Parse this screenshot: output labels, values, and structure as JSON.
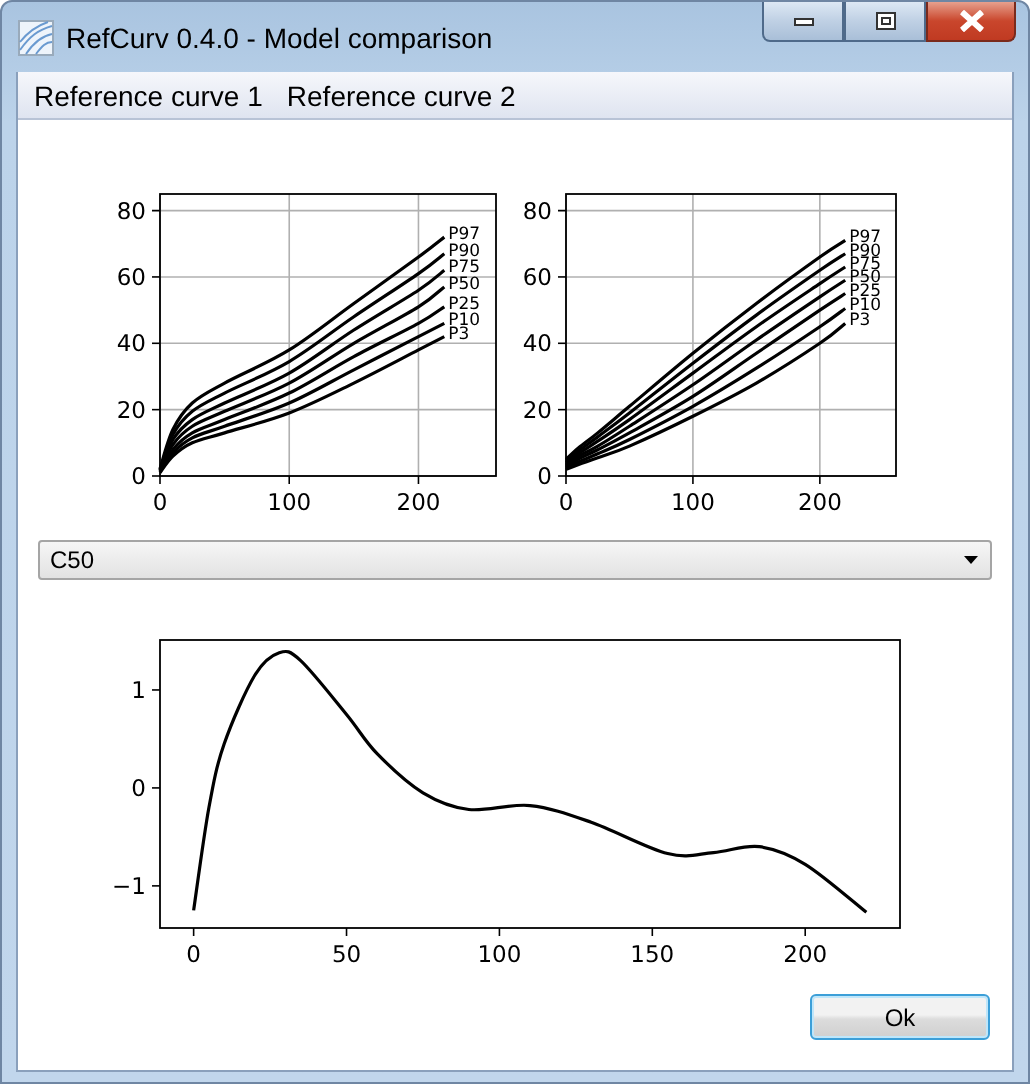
{
  "window": {
    "title": "RefCurv 0.4.0 - Model comparison"
  },
  "menu": [
    "Reference curve 1",
    "Reference curve 2"
  ],
  "curve_plots": [
    {
      "chart_data": {
        "type": "line",
        "grid": true,
        "x": [
          0,
          10,
          25,
          50,
          100,
          150,
          200,
          220
        ],
        "xlim": [
          0,
          260
        ],
        "ylim": [
          0,
          85
        ],
        "xticks": [
          0,
          100,
          200
        ],
        "yticks": [
          0,
          20,
          40,
          60,
          80
        ],
        "series": [
          {
            "name": "P97",
            "color": "#000000",
            "values": [
              2.2,
              14,
              22,
              28,
              38,
              52,
              66,
              72
            ]
          },
          {
            "name": "P90",
            "color": "#000000",
            "values": [
              2,
              12.5,
              19.5,
              25,
              34.5,
              48,
              61,
              67
            ]
          },
          {
            "name": "P75",
            "color": "#000000",
            "values": [
              1.8,
              11,
              17,
              22,
              31,
              44,
              56,
              62
            ]
          },
          {
            "name": "P50",
            "color": "#000000",
            "values": [
              1.6,
              9.5,
              15,
              19.5,
              28,
              40,
              51,
              57
            ]
          },
          {
            "name": "P25",
            "color": "#000000",
            "values": [
              1.4,
              8,
              13,
              17,
              25,
              36,
              46,
              51
            ]
          },
          {
            "name": "P10",
            "color": "#000000",
            "values": [
              1.2,
              7,
              11.5,
              15,
              22,
              32,
              42,
              46
            ]
          },
          {
            "name": "P3",
            "color": "#000000",
            "values": [
              1,
              6,
              10,
              13,
              19,
              28,
              38,
              42
            ]
          }
        ]
      }
    },
    {
      "chart_data": {
        "type": "line",
        "grid": true,
        "x": [
          0,
          10,
          25,
          50,
          100,
          150,
          200,
          220
        ],
        "xlim": [
          0,
          260
        ],
        "ylim": [
          0,
          85
        ],
        "xticks": [
          0,
          100,
          200
        ],
        "yticks": [
          0,
          20,
          40,
          60,
          80
        ],
        "series": [
          {
            "name": "P97",
            "color": "#000000",
            "values": [
              5,
              8.5,
              13,
              21,
              37,
              52,
              66,
              71
            ]
          },
          {
            "name": "P90",
            "color": "#000000",
            "values": [
              4.5,
              7.6,
              11.8,
              19,
              34,
              48.5,
              62,
              67
            ]
          },
          {
            "name": "P75",
            "color": "#000000",
            "values": [
              4,
              6.8,
              10.5,
              17,
              31,
              45,
              58,
              63
            ]
          },
          {
            "name": "P50",
            "color": "#000000",
            "values": [
              3.5,
              6,
              9,
              15,
              27.5,
              41,
              54,
              59
            ]
          },
          {
            "name": "P25",
            "color": "#000000",
            "values": [
              3,
              5.2,
              7.9,
              13,
              24,
              37,
              50,
              55
            ]
          },
          {
            "name": "P10",
            "color": "#000000",
            "values": [
              2.5,
              4.3,
              6.7,
              11,
              21,
              32.5,
              45,
              50.5
            ]
          },
          {
            "name": "P3",
            "color": "#000000",
            "values": [
              2,
              3.5,
              5.5,
              9,
              18,
              28,
              40,
              46
            ]
          }
        ]
      }
    }
  ],
  "model_select": {
    "value": "C50"
  },
  "difference_plot": {
    "chart_data": {
      "type": "line",
      "grid": false,
      "x": [
        0,
        5,
        10,
        20,
        28,
        35,
        50,
        60,
        75,
        90,
        110,
        130,
        155,
        170,
        185,
        200,
        220
      ],
      "xlim": [
        -11,
        231
      ],
      "ylim": [
        -1.43,
        1.51
      ],
      "xticks": [
        0,
        50,
        100,
        150,
        200
      ],
      "yticks": [
        {
          "value": -1,
          "label": "−1"
        },
        0,
        1
      ],
      "series": [
        {
          "color": "#000000",
          "values": [
            -1.25,
            -0.2,
            0.45,
            1.15,
            1.38,
            1.3,
            0.75,
            0.35,
            -0.05,
            -0.22,
            -0.18,
            -0.35,
            -0.67,
            -0.66,
            -0.6,
            -0.78,
            -1.27
          ]
        }
      ]
    }
  },
  "buttons": [
    {
      "label": "Ok",
      "focused": true
    }
  ]
}
